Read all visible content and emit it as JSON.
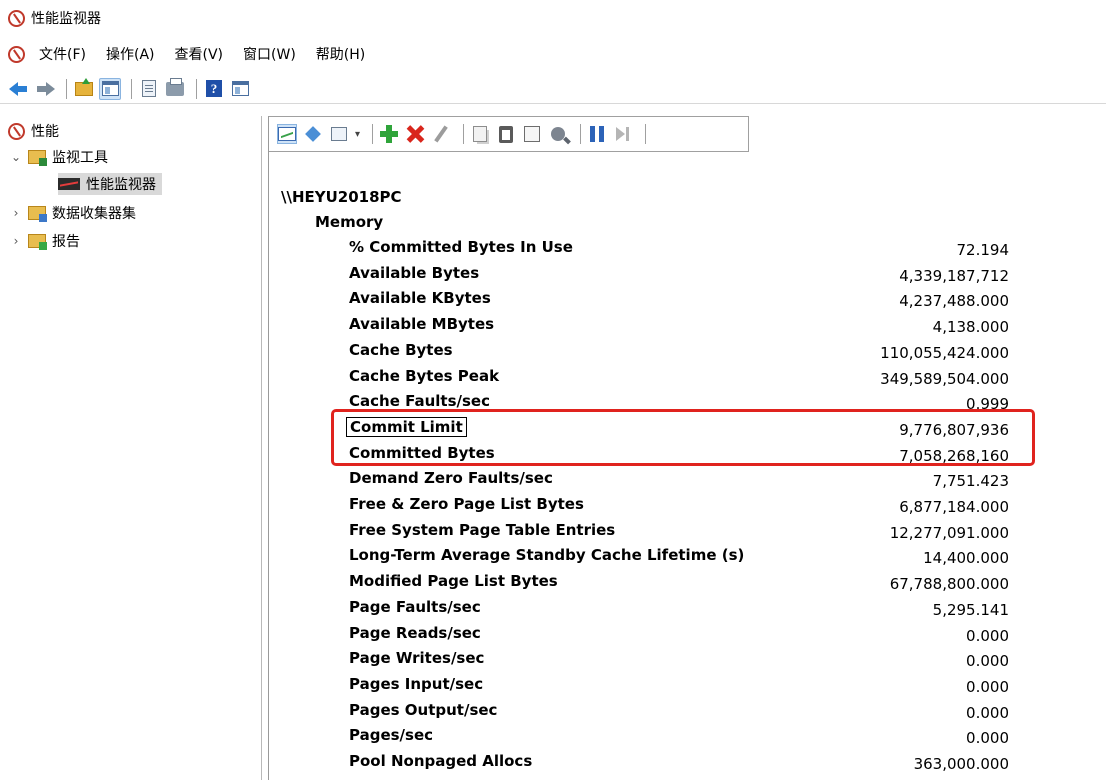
{
  "window": {
    "title": "性能监视器"
  },
  "menu": [
    "文件(F)",
    "操作(A)",
    "查看(V)",
    "窗口(W)",
    "帮助(H)"
  ],
  "toolbar": {
    "icons": [
      "back-arrow-icon",
      "forward-arrow-icon",
      "up-folder-icon",
      "show-hide-tree-icon",
      "properties-icon",
      "print-icon",
      "help-icon",
      "show-hide-action-pane-icon"
    ],
    "help_glyph": "?"
  },
  "tree": {
    "root": "性能",
    "monitoring_tools": "监视工具",
    "perf_monitor": "性能监视器",
    "data_collector_sets": "数据收集器集",
    "reports": "报告"
  },
  "report": {
    "machine": "\\\\HEYU2018PC",
    "object": "Memory",
    "counters": [
      {
        "name": "% Committed Bytes In Use",
        "value": "72.194"
      },
      {
        "name": "Available Bytes",
        "value": "4,339,187,712"
      },
      {
        "name": "Available KBytes",
        "value": "4,237,488.000"
      },
      {
        "name": "Available MBytes",
        "value": "4,138.000"
      },
      {
        "name": "Cache Bytes",
        "value": "110,055,424.000"
      },
      {
        "name": "Cache Bytes Peak",
        "value": "349,589,504.000"
      },
      {
        "name": "Cache Faults/sec",
        "value": "0.999"
      },
      {
        "name": "Commit Limit",
        "value": "9,776,807,936"
      },
      {
        "name": "Committed Bytes",
        "value": "7,058,268,160"
      },
      {
        "name": "Demand Zero Faults/sec",
        "value": "7,751.423"
      },
      {
        "name": "Free & Zero Page List Bytes",
        "value": "6,877,184.000"
      },
      {
        "name": "Free System Page Table Entries",
        "value": "12,277,091.000"
      },
      {
        "name": "Long-Term Average Standby Cache Lifetime (s)",
        "value": "14,400.000"
      },
      {
        "name": "Modified Page List Bytes",
        "value": "67,788,800.000"
      },
      {
        "name": "Page Faults/sec",
        "value": "5,295.141"
      },
      {
        "name": "Page Reads/sec",
        "value": "0.000"
      },
      {
        "name": "Page Writes/sec",
        "value": "0.000"
      },
      {
        "name": "Pages Input/sec",
        "value": "0.000"
      },
      {
        "name": "Pages Output/sec",
        "value": "0.000"
      },
      {
        "name": "Pages/sec",
        "value": "0.000"
      },
      {
        "name": "Pool Nonpaged Allocs",
        "value": "363,000.000"
      }
    ]
  },
  "colors": {
    "highlight": "#e0231e",
    "accent": "#2a7fd4"
  }
}
